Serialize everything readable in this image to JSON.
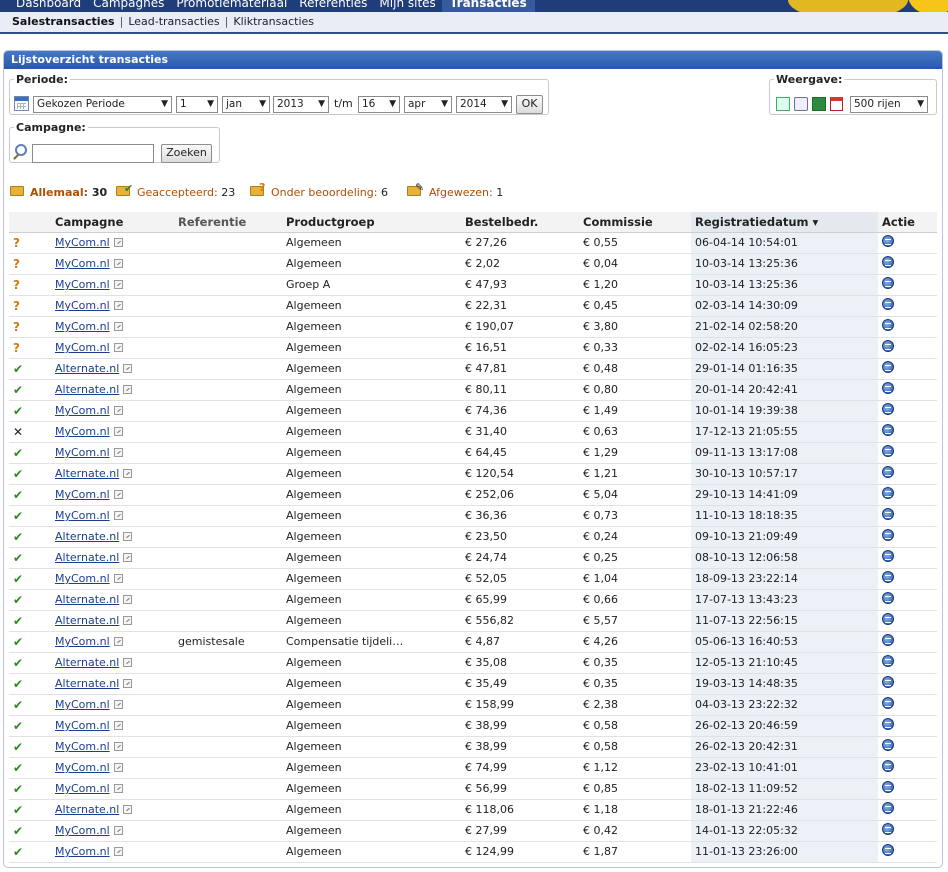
{
  "topnav": {
    "tabs": [
      "Dashboard",
      "Campagnes",
      "Promotiemateriaal",
      "Referenties",
      "Mijn sites",
      "Transacties"
    ]
  },
  "subnav": {
    "items": [
      "Salestransacties",
      "Lead-transacties",
      "Kliktransacties"
    ]
  },
  "panel": {
    "title": "Lijstoverzicht transacties"
  },
  "periode": {
    "legend": "Periode:",
    "preset": "Gekozen Periode",
    "from_day": "1",
    "from_month": "jan",
    "from_year": "2013",
    "tm": "t/m",
    "to_day": "16",
    "to_month": "apr",
    "to_year": "2014",
    "ok": "OK"
  },
  "weergave": {
    "legend": "Weergave:",
    "rows": "500 rijen"
  },
  "campagne": {
    "legend": "Campagne:",
    "value": "",
    "search": "Zoeken"
  },
  "filters": {
    "all_label": "Allemaal:",
    "all_count": "30",
    "accepted_label": "Geaccepteerd:",
    "accepted_count": "23",
    "review_label": "Onder beoordeling:",
    "review_count": "6",
    "rejected_label": "Afgewezen:",
    "rejected_count": "1"
  },
  "table": {
    "headers": {
      "campagne": "Campagne",
      "referentie": "Referentie",
      "productgroep": "Productgroep",
      "bestelbedr": "Bestelbedr.",
      "commissie": "Commissie",
      "registratie": "Registratiedatum ▾",
      "actie": "Actie"
    },
    "rows": [
      {
        "s": "?",
        "c": "MyCom.nl",
        "r": "",
        "p": "Algemeen",
        "b": "€ 27,26",
        "k": "€ 0,55",
        "d": "06-04-14 10:54:01"
      },
      {
        "s": "?",
        "c": "MyCom.nl",
        "r": "",
        "p": "Algemeen",
        "b": "€ 2,02",
        "k": "€ 0,04",
        "d": "10-03-14 13:25:36"
      },
      {
        "s": "?",
        "c": "MyCom.nl",
        "r": "",
        "p": "Groep A",
        "b": "€ 47,93",
        "k": "€ 1,20",
        "d": "10-03-14 13:25:36"
      },
      {
        "s": "?",
        "c": "MyCom.nl",
        "r": "",
        "p": "Algemeen",
        "b": "€ 22,31",
        "k": "€ 0,45",
        "d": "02-03-14 14:30:09"
      },
      {
        "s": "?",
        "c": "MyCom.nl",
        "r": "",
        "p": "Algemeen",
        "b": "€ 190,07",
        "k": "€ 3,80",
        "d": "21-02-14 02:58:20"
      },
      {
        "s": "?",
        "c": "MyCom.nl",
        "r": "",
        "p": "Algemeen",
        "b": "€ 16,51",
        "k": "€ 0,33",
        "d": "02-02-14 16:05:23"
      },
      {
        "s": "✔",
        "c": "Alternate.nl",
        "r": "",
        "p": "Algemeen",
        "b": "€ 47,81",
        "k": "€ 0,48",
        "d": "29-01-14 01:16:35"
      },
      {
        "s": "✔",
        "c": "Alternate.nl",
        "r": "",
        "p": "Algemeen",
        "b": "€ 80,11",
        "k": "€ 0,80",
        "d": "20-01-14 20:42:41"
      },
      {
        "s": "✔",
        "c": "MyCom.nl",
        "r": "",
        "p": "Algemeen",
        "b": "€ 74,36",
        "k": "€ 1,49",
        "d": "10-01-14 19:39:38"
      },
      {
        "s": "✕",
        "c": "MyCom.nl",
        "r": "",
        "p": "Algemeen",
        "b": "€ 31,40",
        "k": "€ 0,63",
        "d": "17-12-13 21:05:55"
      },
      {
        "s": "✔",
        "c": "MyCom.nl",
        "r": "",
        "p": "Algemeen",
        "b": "€ 64,45",
        "k": "€ 1,29",
        "d": "09-11-13 13:17:08"
      },
      {
        "s": "✔",
        "c": "Alternate.nl",
        "r": "",
        "p": "Algemeen",
        "b": "€ 120,54",
        "k": "€ 1,21",
        "d": "30-10-13 10:57:17"
      },
      {
        "s": "✔",
        "c": "MyCom.nl",
        "r": "",
        "p": "Algemeen",
        "b": "€ 252,06",
        "k": "€ 5,04",
        "d": "29-10-13 14:41:09"
      },
      {
        "s": "✔",
        "c": "MyCom.nl",
        "r": "",
        "p": "Algemeen",
        "b": "€ 36,36",
        "k": "€ 0,73",
        "d": "11-10-13 18:18:35"
      },
      {
        "s": "✔",
        "c": "Alternate.nl",
        "r": "",
        "p": "Algemeen",
        "b": "€ 23,50",
        "k": "€ 0,24",
        "d": "09-10-13 21:09:49"
      },
      {
        "s": "✔",
        "c": "Alternate.nl",
        "r": "",
        "p": "Algemeen",
        "b": "€ 24,74",
        "k": "€ 0,25",
        "d": "08-10-13 12:06:58"
      },
      {
        "s": "✔",
        "c": "MyCom.nl",
        "r": "",
        "p": "Algemeen",
        "b": "€ 52,05",
        "k": "€ 1,04",
        "d": "18-09-13 23:22:14"
      },
      {
        "s": "✔",
        "c": "Alternate.nl",
        "r": "",
        "p": "Algemeen",
        "b": "€ 65,99",
        "k": "€ 0,66",
        "d": "17-07-13 13:43:23"
      },
      {
        "s": "✔",
        "c": "Alternate.nl",
        "r": "",
        "p": "Algemeen",
        "b": "€ 556,82",
        "k": "€ 5,57",
        "d": "11-07-13 22:56:15"
      },
      {
        "s": "✔",
        "c": "MyCom.nl",
        "r": "gemistesale",
        "p": "Compensatie tijdeli…",
        "b": "€ 4,87",
        "k": "€ 4,26",
        "d": "05-06-13 16:40:53"
      },
      {
        "s": "✔",
        "c": "Alternate.nl",
        "r": "",
        "p": "Algemeen",
        "b": "€ 35,08",
        "k": "€ 0,35",
        "d": "12-05-13 21:10:45"
      },
      {
        "s": "✔",
        "c": "Alternate.nl",
        "r": "",
        "p": "Algemeen",
        "b": "€ 35,49",
        "k": "€ 0,35",
        "d": "19-03-13 14:48:35"
      },
      {
        "s": "✔",
        "c": "MyCom.nl",
        "r": "",
        "p": "Algemeen",
        "b": "€ 158,99",
        "k": "€ 2,38",
        "d": "04-03-13 23:22:32"
      },
      {
        "s": "✔",
        "c": "MyCom.nl",
        "r": "",
        "p": "Algemeen",
        "b": "€ 38,99",
        "k": "€ 0,58",
        "d": "26-02-13 20:46:59"
      },
      {
        "s": "✔",
        "c": "MyCom.nl",
        "r": "",
        "p": "Algemeen",
        "b": "€ 38,99",
        "k": "€ 0,58",
        "d": "26-02-13 20:42:31"
      },
      {
        "s": "✔",
        "c": "MyCom.nl",
        "r": "",
        "p": "Algemeen",
        "b": "€ 74,99",
        "k": "€ 1,12",
        "d": "23-02-13 10:41:01"
      },
      {
        "s": "✔",
        "c": "MyCom.nl",
        "r": "",
        "p": "Algemeen",
        "b": "€ 56,99",
        "k": "€ 0,85",
        "d": "18-02-13 11:09:52"
      },
      {
        "s": "✔",
        "c": "Alternate.nl",
        "r": "",
        "p": "Algemeen",
        "b": "€ 118,06",
        "k": "€ 1,18",
        "d": "18-01-13 21:22:46"
      },
      {
        "s": "✔",
        "c": "MyCom.nl",
        "r": "",
        "p": "Algemeen",
        "b": "€ 27,99",
        "k": "€ 0,42",
        "d": "14-01-13 22:05:32"
      },
      {
        "s": "✔",
        "c": "MyCom.nl",
        "r": "",
        "p": "Algemeen",
        "b": "€ 124,99",
        "k": "€ 1,87",
        "d": "11-01-13 23:26:00"
      }
    ]
  }
}
